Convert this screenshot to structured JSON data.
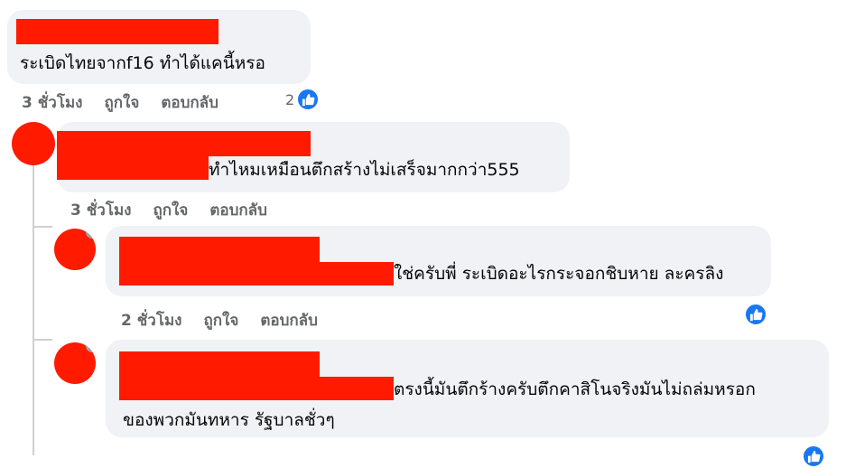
{
  "comments": [
    {
      "text": "ระเบิดไทยจากf16 ทำได้แคนี้หรอ",
      "time": "3 ชั่วโมง",
      "like_label": "ถูกใจ",
      "reply_label": "ตอบกลับ",
      "reaction_count": "2"
    },
    {
      "text": "ทำไหมเหมือนตึกสร้างไม่เสร็จมากกว่า555",
      "time": "3 ชั่วโมง",
      "like_label": "ถูกใจ",
      "reply_label": "ตอบกลับ"
    },
    {
      "text": "ใช่ครับพี่ ระเบิดอะไรกระจอกชิบหาย ละครลิง",
      "time": "2 ชั่วโมง",
      "like_label": "ถูกใจ",
      "reply_label": "ตอบกลับ"
    },
    {
      "text_line1": "ตรงนี้มันตึกร้างครับตึกคาสิโนจริงมันไม่ถล่มหรอก",
      "text_line2": "ของพวกมันทหาร รัฐบาลชั่วๆ"
    }
  ],
  "icons": {
    "like": "thumbs-up-icon"
  },
  "colors": {
    "accent": "#1877f2",
    "redaction": "#ff1a00",
    "bubble": "#f0f2f5",
    "meta": "#65676b"
  }
}
